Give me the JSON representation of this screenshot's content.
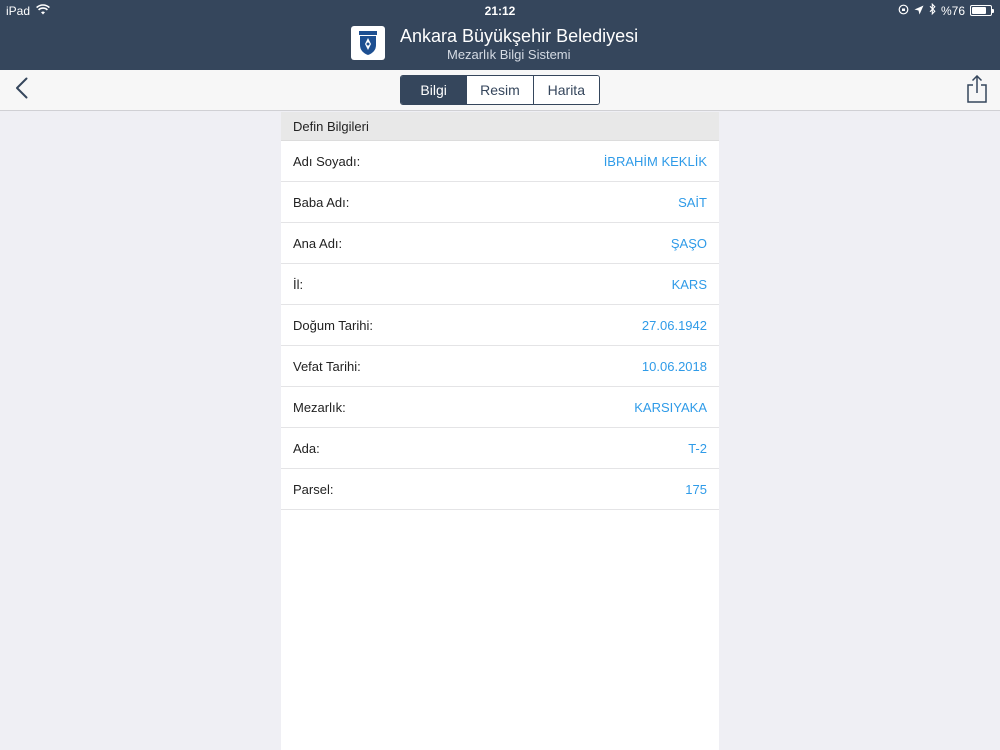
{
  "status_bar": {
    "device": "iPad",
    "time": "21:12",
    "battery": "%76",
    "battery_level": 0.76
  },
  "header": {
    "title": "Ankara Büyükşehir Belediyesi",
    "subtitle": "Mezarlık Bilgi Sistemi"
  },
  "tabs": [
    {
      "label": "Bilgi",
      "active": true
    },
    {
      "label": "Resim",
      "active": false
    },
    {
      "label": "Harita",
      "active": false
    }
  ],
  "section": {
    "title": "Defin Bilgileri",
    "rows": [
      {
        "label": "Adı Soyadı:",
        "value": "İBRAHİM KEKLİK"
      },
      {
        "label": "Baba Adı:",
        "value": "SAİT"
      },
      {
        "label": "Ana Adı:",
        "value": "ŞAŞO"
      },
      {
        "label": "İl:",
        "value": "KARS"
      },
      {
        "label": "Doğum Tarihi:",
        "value": "27.06.1942"
      },
      {
        "label": "Vefat Tarihi:",
        "value": "10.06.2018"
      },
      {
        "label": "Mezarlık:",
        "value": "KARSIYAKA"
      },
      {
        "label": "Ada:",
        "value": "T-2"
      },
      {
        "label": "Parsel:",
        "value": "175"
      }
    ]
  },
  "colors": {
    "header_bg": "#35465c",
    "value_text": "#2f9be8",
    "background": "#efeff4"
  }
}
